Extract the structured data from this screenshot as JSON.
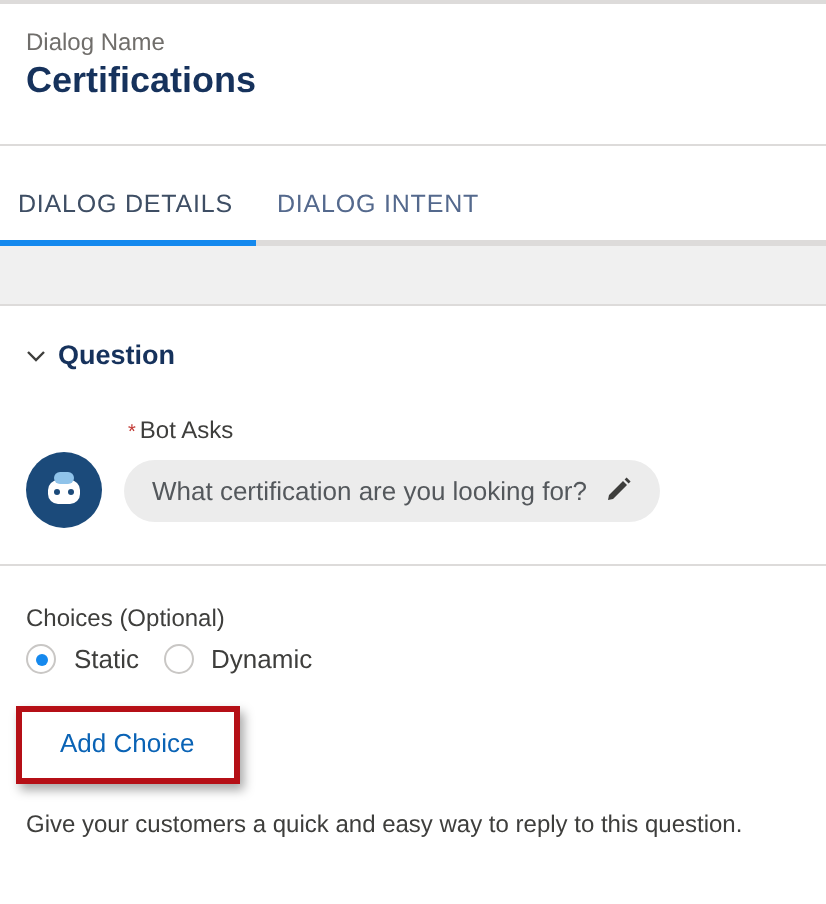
{
  "header": {
    "label": "Dialog Name",
    "title": "Certifications"
  },
  "tabs": [
    {
      "label": "DIALOG DETAILS",
      "selected": true
    },
    {
      "label": "DIALOG INTENT",
      "selected": false
    }
  ],
  "section": {
    "title": "Question",
    "expanded": true
  },
  "bot_asks": {
    "required_mark": "*",
    "label": "Bot Asks",
    "value": "What certification are you looking for?"
  },
  "choices": {
    "label": "Choices (Optional)",
    "options": [
      {
        "label": "Static",
        "selected": true
      },
      {
        "label": "Dynamic",
        "selected": false
      }
    ],
    "add_button": "Add Choice",
    "highlighted": true,
    "help": "Give your customers a quick and easy way to reply to this question."
  }
}
